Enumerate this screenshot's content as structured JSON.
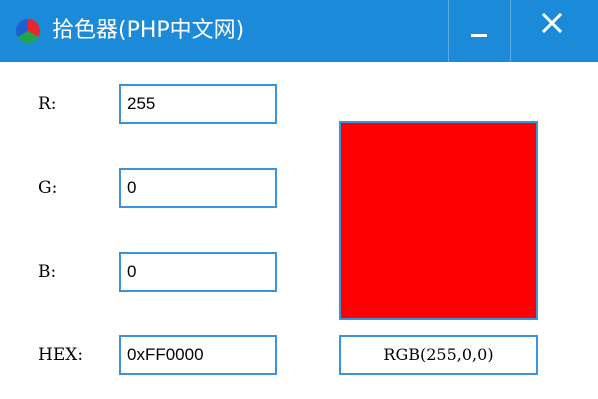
{
  "window": {
    "title": "拾色器(PHP中文网)",
    "accent_color": "#1a8ad9",
    "app_icon": "color-wheel-icon",
    "minimize_icon": "minimize-icon",
    "close_icon": "close-icon"
  },
  "fields": {
    "r": {
      "label": "R:",
      "value": "255"
    },
    "g": {
      "label": "G:",
      "value": "0"
    },
    "b": {
      "label": "B:",
      "value": "0"
    },
    "hex": {
      "label": "HEX:",
      "value": "0xFF0000"
    }
  },
  "preview": {
    "color": "#ff0000",
    "rgb_text": "RGB(255,0,0)"
  }
}
